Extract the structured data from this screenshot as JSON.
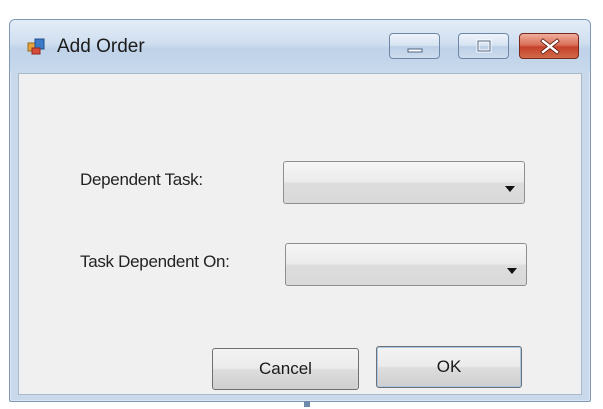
{
  "window": {
    "title": "Add Order",
    "icons": {
      "app": "application-icon",
      "minimize": "minimize-icon",
      "maximize": "maximize-icon",
      "close": "close-icon"
    }
  },
  "form": {
    "dependent_task": {
      "label": "Dependent Task:",
      "value": ""
    },
    "task_dependent_on": {
      "label": "Task Dependent On:",
      "value": ""
    }
  },
  "buttons": {
    "cancel": "Cancel",
    "ok": "OK"
  },
  "colors": {
    "client_bg": "#f0f0f0",
    "titlebar": "#cfdeef",
    "close_button": "#c4412a"
  }
}
